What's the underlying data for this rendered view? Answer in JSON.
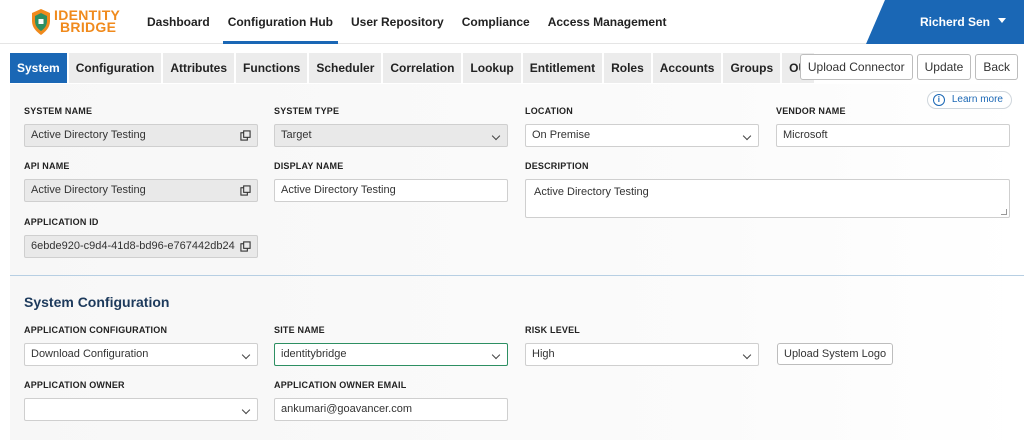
{
  "logo": {
    "line1": "IDENTITY",
    "line2": "BRIDGE"
  },
  "nav": {
    "items": [
      "Dashboard",
      "Configuration Hub",
      "User Repository",
      "Compliance",
      "Access Management"
    ],
    "active": "Configuration Hub"
  },
  "user": {
    "name": "Richerd Sen"
  },
  "tabs": {
    "items": [
      "System",
      "Configuration",
      "Attributes",
      "Functions",
      "Scheduler",
      "Correlation",
      "Lookup",
      "Entitlement",
      "Roles",
      "Accounts",
      "Groups",
      "OU"
    ],
    "active": "System"
  },
  "actions": {
    "upload_connector": "Upload Connector",
    "update": "Update",
    "back": "Back"
  },
  "learn_more": "Learn more",
  "system": {
    "system_name_label": "SYSTEM NAME",
    "system_name": "Active Directory Testing",
    "system_type_label": "SYSTEM TYPE",
    "system_type": "Target",
    "location_label": "LOCATION",
    "location": "On Premise",
    "vendor_name_label": "VENDOR NAME",
    "vendor_name": "Microsoft",
    "api_name_label": "API NAME",
    "api_name": "Active Directory Testing",
    "display_name_label": "DISPLAY NAME",
    "display_name": "Active Directory Testing",
    "description_label": "DESCRIPTION",
    "description": "Active Directory Testing",
    "application_id_label": "APPLICATION ID",
    "application_id": "6ebde920-c9d4-41d8-bd96-e767442db24"
  },
  "system_config": {
    "title": "System Configuration",
    "app_config_label": "APPLICATION CONFIGURATION",
    "app_config": "Download Configuration",
    "site_name_label": "SITE NAME",
    "site_name": "identitybridge",
    "risk_level_label": "RISK LEVEL",
    "risk_level": "High",
    "upload_logo": "Upload System Logo",
    "app_owner_label": "APPLICATION OWNER",
    "app_owner": "",
    "app_owner_email_label": "APPLICATION OWNER EMAIL",
    "app_owner_email": "ankumari@goavancer.com"
  },
  "colors": {
    "primary": "#1a67b5",
    "brand": "#f08a1c",
    "focus": "#2d8f62"
  }
}
